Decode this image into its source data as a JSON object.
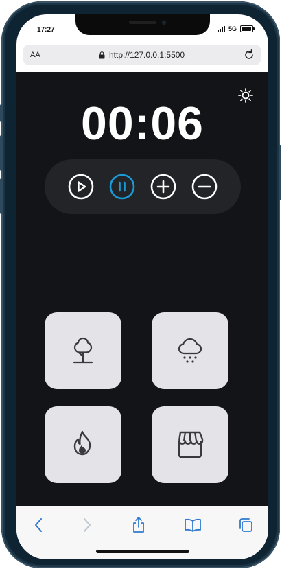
{
  "status_bar": {
    "time": "17:27",
    "network": "5G",
    "signal_bars": 4,
    "battery_level": 0.9
  },
  "browser": {
    "text_size_label": "AA",
    "url": "http://127.0.0.1:5500",
    "toolbar_icons": [
      "back-icon",
      "forward-icon",
      "share-icon",
      "bookmarks-icon",
      "tabs-icon"
    ]
  },
  "app": {
    "timer_display": "00:06",
    "theme_toggle_icon": "sun-icon",
    "controls": [
      "play-icon",
      "pause-icon",
      "plus-icon",
      "minus-icon"
    ],
    "sound_tiles": [
      "tree-icon",
      "snow-cloud-icon",
      "flame-icon",
      "store-icon"
    ]
  },
  "colors": {
    "app_background": "#131417",
    "controls_background": "#232428",
    "accent": "#1a9ad6",
    "tile_background": "#e4e4e8",
    "browser_tint": "#2f7ad0"
  }
}
